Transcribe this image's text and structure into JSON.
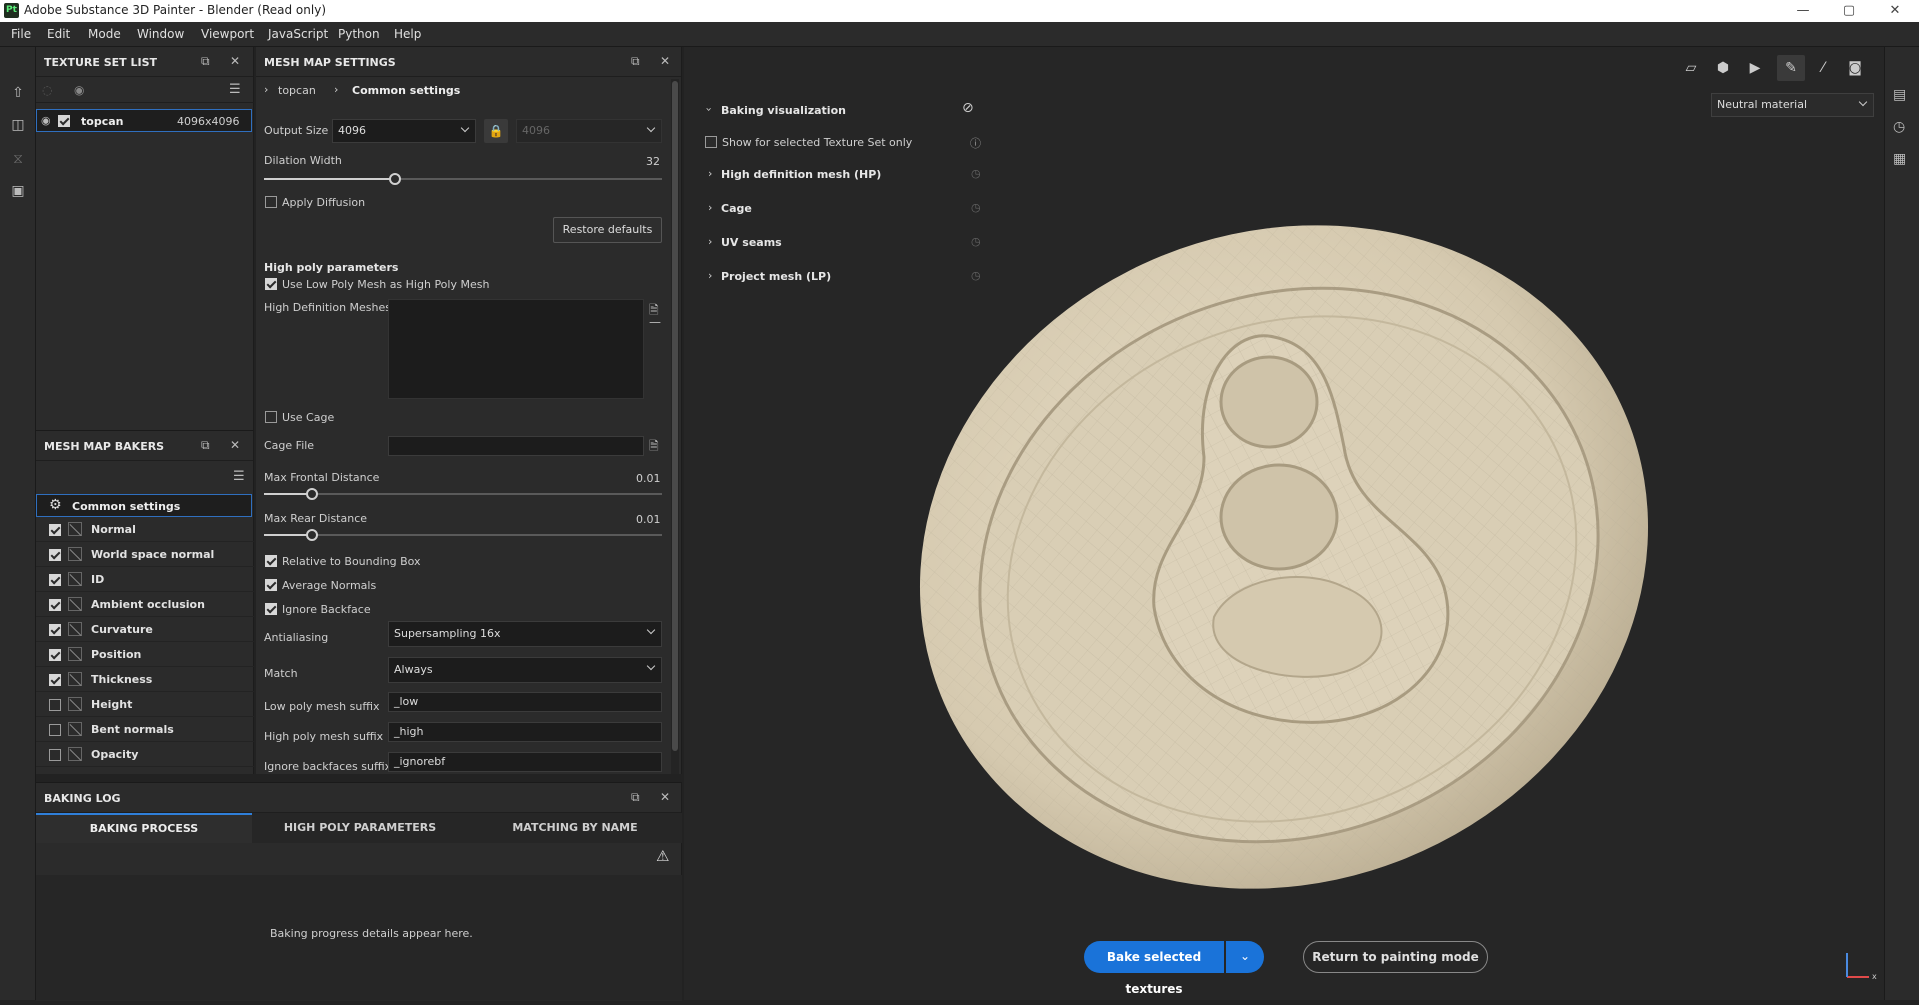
{
  "titlebar": {
    "logo": "Pt",
    "title": "Adobe Substance 3D Painter - Blender (Read only)",
    "minimize": "—",
    "maximize": "▢",
    "close": "✕"
  },
  "menu": [
    "File",
    "Edit",
    "Mode",
    "Window",
    "Viewport",
    "JavaScript",
    "Python",
    "Help"
  ],
  "texture_set_list": {
    "title": "TEXTURE SET LIST",
    "item": {
      "name": "topcan",
      "size": "4096x4096"
    }
  },
  "mesh_map_bakers": {
    "title": "MESH MAP BAKERS",
    "common": "Common settings",
    "items": [
      {
        "label": "Normal",
        "checked": true
      },
      {
        "label": "World space normal",
        "checked": true
      },
      {
        "label": "ID",
        "checked": true
      },
      {
        "label": "Ambient occlusion",
        "checked": true
      },
      {
        "label": "Curvature",
        "checked": true
      },
      {
        "label": "Position",
        "checked": true
      },
      {
        "label": "Thickness",
        "checked": true
      },
      {
        "label": "Height",
        "checked": false
      },
      {
        "label": "Bent normals",
        "checked": false
      },
      {
        "label": "Opacity",
        "checked": false
      }
    ]
  },
  "mesh_map_settings": {
    "title": "MESH MAP SETTINGS",
    "breadcrumb": [
      "topcan",
      "Common settings"
    ],
    "output_size_label": "Output Size",
    "output_size": "4096",
    "output_size_locked": "4096",
    "dilation_label": "Dilation Width",
    "dilation_value": "32",
    "dilation_fraction": 0.33,
    "apply_diffusion": "Apply Diffusion",
    "restore_defaults": "Restore defaults",
    "high_poly_header": "High poly parameters",
    "use_low_poly": "Use Low Poly Mesh as High Poly Mesh",
    "hd_meshes": "High Definition Meshes",
    "use_cage": "Use Cage",
    "cage_file": "Cage File",
    "max_frontal_label": "Max Frontal Distance",
    "max_frontal_value": "0.01",
    "max_frontal_fraction": 0.12,
    "max_rear_label": "Max Rear Distance",
    "max_rear_value": "0.01",
    "max_rear_fraction": 0.12,
    "relative_bbox": "Relative to Bounding Box",
    "average_normals": "Average Normals",
    "ignore_backface": "Ignore Backface",
    "antialiasing_label": "Antialiasing",
    "antialiasing": "Supersampling 16x",
    "match_label": "Match",
    "match": "Always",
    "low_suffix_label": "Low poly mesh suffix",
    "low_suffix": "_low",
    "high_suffix_label": "High poly mesh suffix",
    "high_suffix": "_high",
    "ignore_suffix_label": "Ignore backfaces suffix",
    "ignore_suffix": "_ignorebf"
  },
  "baking_log": {
    "title": "BAKING LOG",
    "tabs": [
      "BAKING PROCESS",
      "HIGH POLY PARAMETERS",
      "MATCHING BY NAME"
    ],
    "message": "Baking progress details appear here."
  },
  "viewport": {
    "baking_vis": "Baking visualization",
    "show_selected": "Show for selected Texture Set only",
    "sections": [
      "High definition mesh (HP)",
      "Cage",
      "UV seams",
      "Project mesh (LP)"
    ],
    "material": "Neutral material",
    "bake_button": "Bake selected textures",
    "return_button": "Return to painting mode",
    "axis_x": "x"
  },
  "colors": {
    "accent": "#1a73d9",
    "panel": "#2b2b2b",
    "mesh": "#d9cfb8"
  }
}
